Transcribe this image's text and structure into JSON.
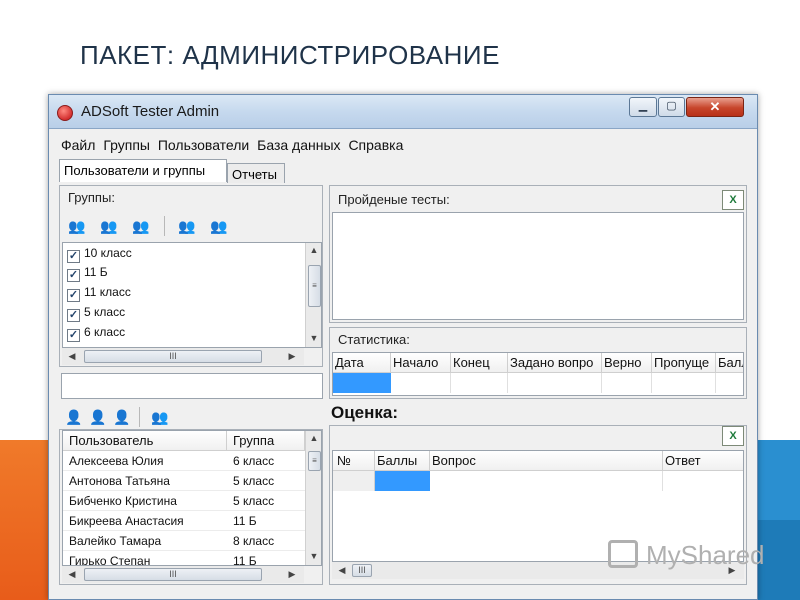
{
  "slide": {
    "title": "ПАКЕТ: АДМИНИСТРИРОВАНИЕ"
  },
  "window": {
    "title": "ADSoft Tester Admin",
    "controls": {
      "minimize": "▁",
      "maximize": "▢",
      "close": "✕"
    }
  },
  "menu": {
    "items": [
      "Файл",
      "Группы",
      "Пользователи",
      "База данных",
      "Справка"
    ]
  },
  "tabs": {
    "active": "Пользователи и группы",
    "other": "Отчеты"
  },
  "groups": {
    "label": "Группы:",
    "items": [
      {
        "label": "10 класс",
        "checked": true
      },
      {
        "label": "11 Б",
        "checked": true
      },
      {
        "label": "11 класс",
        "checked": true
      },
      {
        "label": "5 класс",
        "checked": true
      },
      {
        "label": "6 класс",
        "checked": true
      }
    ],
    "scroll_grip": "III"
  },
  "users": {
    "columns": [
      "Пользователь",
      "Группа"
    ],
    "rows": [
      [
        "Алексеева Юлия",
        "6 класс"
      ],
      [
        "Антонова Татьяна",
        "5 класс"
      ],
      [
        "Бибченко Кристина",
        "5 класс"
      ],
      [
        "Бикреева Анастасия",
        "11 Б"
      ],
      [
        "Валейко Тамара",
        "8 класс"
      ],
      [
        "Гирько Степан",
        "11 Б"
      ]
    ],
    "scroll_grip": "III"
  },
  "tests": {
    "label": "Пройденые тесты:"
  },
  "stats": {
    "label": "Статистика:",
    "columns": [
      "Дата",
      "Начало",
      "Конец",
      "Задано вопро",
      "Верно",
      "Пропуще",
      "Балл"
    ]
  },
  "grade": {
    "label": "Оценка:",
    "columns": [
      "№",
      "Баллы",
      "Вопрос",
      "Ответ"
    ],
    "scroll_grip": "III"
  },
  "icons": {
    "excel": "X",
    "watermark_text": "MyShared"
  },
  "colors": {
    "selection": "#3399ff",
    "title_color": "#1f3349"
  }
}
